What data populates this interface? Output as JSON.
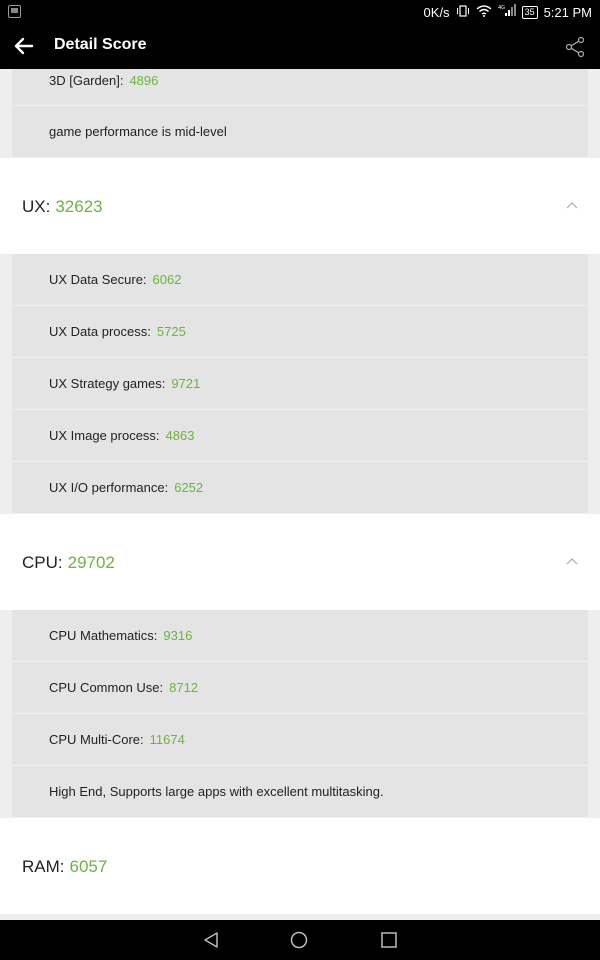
{
  "status_bar": {
    "speed": "0K/s",
    "network": "4G",
    "battery": "35",
    "time": "5:21 PM"
  },
  "app_bar": {
    "title": "Detail Score"
  },
  "top_rows": [
    {
      "label": "3D [Garden]:",
      "value": "4896"
    },
    {
      "label": "game performance is mid-level",
      "value": ""
    }
  ],
  "ux": {
    "label": "UX:",
    "score": "32623",
    "rows": [
      {
        "label": "UX Data Secure:",
        "value": "6062"
      },
      {
        "label": "UX Data process:",
        "value": "5725"
      },
      {
        "label": "UX Strategy games:",
        "value": "9721"
      },
      {
        "label": "UX Image process:",
        "value": "4863"
      },
      {
        "label": "UX I/O performance:",
        "value": "6252"
      }
    ]
  },
  "cpu": {
    "label": "CPU:",
    "score": "29702",
    "rows": [
      {
        "label": "CPU Mathematics:",
        "value": "9316"
      },
      {
        "label": "CPU Common Use:",
        "value": "8712"
      },
      {
        "label": "CPU Multi-Core:",
        "value": "11674"
      },
      {
        "label": "High End, Supports large apps with excellent multitasking.",
        "value": ""
      }
    ]
  },
  "ram": {
    "label": "RAM:",
    "score": "6057"
  },
  "colors": {
    "accent": "#6db33f",
    "app_bar": "#000000",
    "row_bg": "#e4e4e4"
  }
}
